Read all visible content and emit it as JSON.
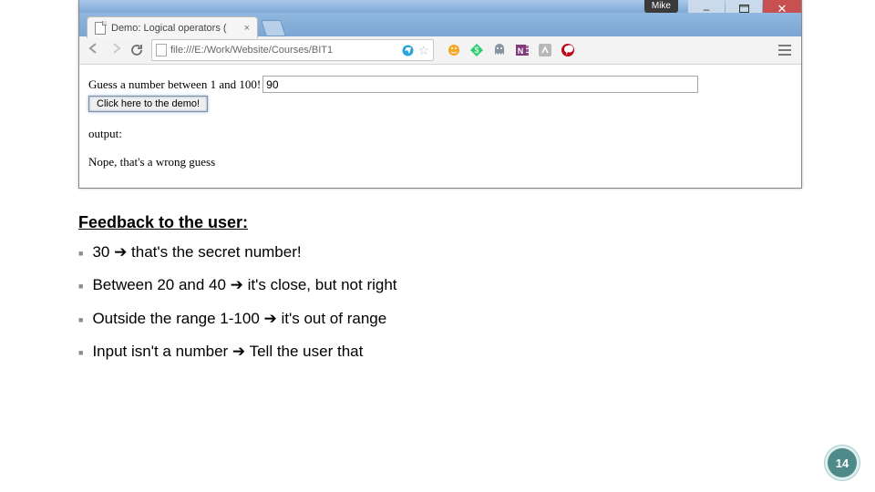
{
  "window": {
    "user_badge": "Mike",
    "tab_title": "Demo: Logical operators (",
    "address": "file:///E:/Work/Website/Courses/BIT1"
  },
  "page": {
    "prompt": "Guess a number between 1 and 100!",
    "guess_value": "90",
    "button_label": "Click here to the demo!",
    "output_label": "output:",
    "output_message": "Nope, that's a wrong guess"
  },
  "slide": {
    "heading": "Feedback to the user:",
    "items": [
      "30 ➔ that's the secret number!",
      "Between 20 and 40 ➔ it's close, but not right",
      "Outside the range 1-100 ➔ it's out of range",
      "Input isn't a number ➔ Tell the user that"
    ],
    "page_number": "14"
  }
}
